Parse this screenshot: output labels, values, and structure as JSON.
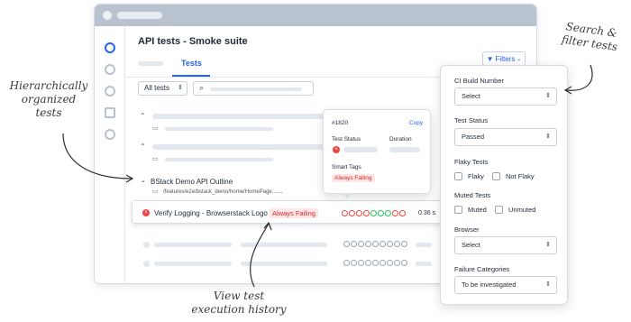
{
  "page": {
    "title": "API tests - Smoke suite",
    "tab_active": "Tests",
    "filters_label": "Filters",
    "all_tests_label": "All tests"
  },
  "tree": {
    "group_label": "BStack Demo API Outline",
    "group_path": "/features/e2e/bstack_demo/home/HomePage.......",
    "highlighted_test": {
      "name": "Verify Logging - Browserstack Logo",
      "status_badge": "Always Failing",
      "duration": "0.36 s"
    }
  },
  "popover": {
    "build_number": "#1820",
    "copy_label": "Copy",
    "test_status_label": "Test Status",
    "duration_label": "Duration",
    "smart_tags_label": "Smart Tags",
    "smart_tag": "Always Falling"
  },
  "filter_panel": {
    "ci_build_label": "CI Build Number",
    "ci_build_value": "Select",
    "test_status_label": "Test Status",
    "test_status_value": "Passed",
    "flaky_label": "Flaky Tests",
    "flaky_option": "Flaky",
    "not_flaky_option": "Not Flaky",
    "muted_label": "Muted Tests",
    "muted_option": "Muted",
    "unmuted_option": "Unmuted",
    "browser_label": "Browser",
    "browser_value": "Select",
    "failure_label": "Failure Categories",
    "failure_value": "To be investigated"
  },
  "annotations": {
    "search_line1": "Search &",
    "search_line2": "filter tests",
    "hier_line1": "Hierarchically",
    "hier_line2": "organized",
    "hier_line3": "tests",
    "history_line1": "View test",
    "history_line2": "execution history"
  },
  "colors": {
    "accent": "#2563eb",
    "fail": "#ef4444",
    "pass": "#22c55e",
    "titlebar": "#b9c3d0"
  }
}
